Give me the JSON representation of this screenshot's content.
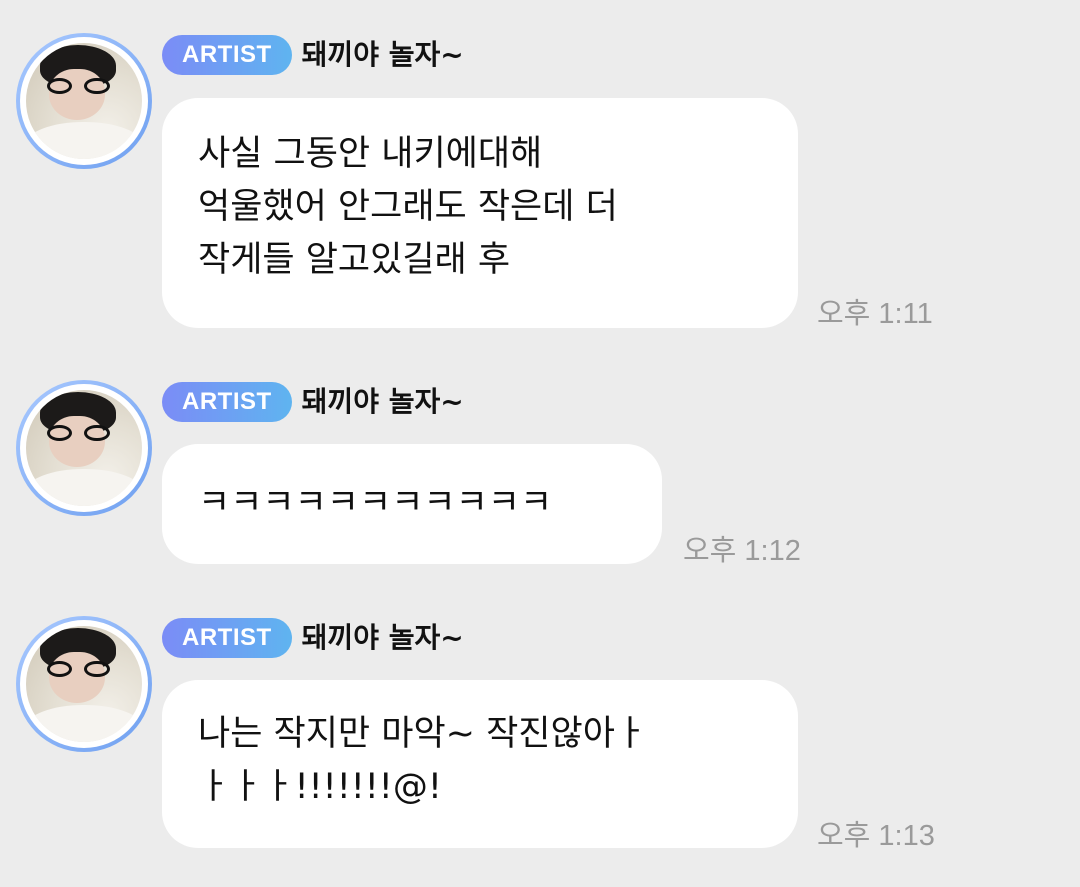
{
  "messages": [
    {
      "badge": "ARTIST",
      "sender": "돼끼야 놀자~",
      "text": "사실 그동안 내키에대해\n억울했어 안그래도 작은데 더\n작게들 알고있길래 후",
      "time": "오후 1:11"
    },
    {
      "badge": "ARTIST",
      "sender": "돼끼야 놀자~",
      "text": "ㅋㅋㅋㅋㅋㅋㅋㅋㅋㅋㅋ",
      "time": "오후 1:12"
    },
    {
      "badge": "ARTIST",
      "sender": "돼끼야 놀자~",
      "text": "나는 작지만 마악~ 작진않아ㅏ\nㅏㅏㅏ!!!!!!!@!",
      "time": "오후 1:13"
    }
  ],
  "colors": {
    "background": "#ececec",
    "bubble": "#ffffff",
    "badge_start": "#7b8cf6",
    "badge_end": "#5fb4f0",
    "avatar_ring": "#6fa0f0",
    "time_text": "#9a9a9a"
  }
}
